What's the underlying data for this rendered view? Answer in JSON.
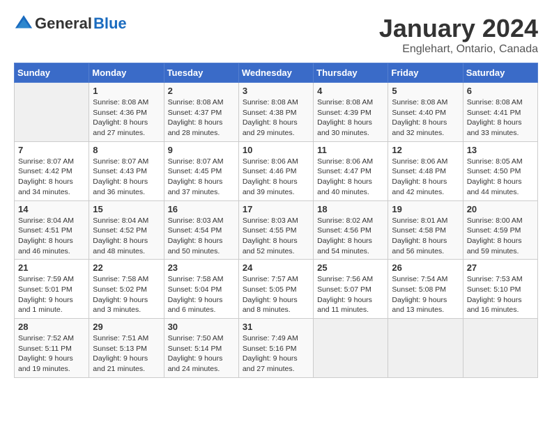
{
  "header": {
    "logo_general": "General",
    "logo_blue": "Blue",
    "title": "January 2024",
    "subtitle": "Englehart, Ontario, Canada"
  },
  "days_of_week": [
    "Sunday",
    "Monday",
    "Tuesday",
    "Wednesday",
    "Thursday",
    "Friday",
    "Saturday"
  ],
  "weeks": [
    [
      {
        "day": "",
        "info": ""
      },
      {
        "day": "1",
        "info": "Sunrise: 8:08 AM\nSunset: 4:36 PM\nDaylight: 8 hours\nand 27 minutes."
      },
      {
        "day": "2",
        "info": "Sunrise: 8:08 AM\nSunset: 4:37 PM\nDaylight: 8 hours\nand 28 minutes."
      },
      {
        "day": "3",
        "info": "Sunrise: 8:08 AM\nSunset: 4:38 PM\nDaylight: 8 hours\nand 29 minutes."
      },
      {
        "day": "4",
        "info": "Sunrise: 8:08 AM\nSunset: 4:39 PM\nDaylight: 8 hours\nand 30 minutes."
      },
      {
        "day": "5",
        "info": "Sunrise: 8:08 AM\nSunset: 4:40 PM\nDaylight: 8 hours\nand 32 minutes."
      },
      {
        "day": "6",
        "info": "Sunrise: 8:08 AM\nSunset: 4:41 PM\nDaylight: 8 hours\nand 33 minutes."
      }
    ],
    [
      {
        "day": "7",
        "info": "Sunrise: 8:07 AM\nSunset: 4:42 PM\nDaylight: 8 hours\nand 34 minutes."
      },
      {
        "day": "8",
        "info": "Sunrise: 8:07 AM\nSunset: 4:43 PM\nDaylight: 8 hours\nand 36 minutes."
      },
      {
        "day": "9",
        "info": "Sunrise: 8:07 AM\nSunset: 4:45 PM\nDaylight: 8 hours\nand 37 minutes."
      },
      {
        "day": "10",
        "info": "Sunrise: 8:06 AM\nSunset: 4:46 PM\nDaylight: 8 hours\nand 39 minutes."
      },
      {
        "day": "11",
        "info": "Sunrise: 8:06 AM\nSunset: 4:47 PM\nDaylight: 8 hours\nand 40 minutes."
      },
      {
        "day": "12",
        "info": "Sunrise: 8:06 AM\nSunset: 4:48 PM\nDaylight: 8 hours\nand 42 minutes."
      },
      {
        "day": "13",
        "info": "Sunrise: 8:05 AM\nSunset: 4:50 PM\nDaylight: 8 hours\nand 44 minutes."
      }
    ],
    [
      {
        "day": "14",
        "info": "Sunrise: 8:04 AM\nSunset: 4:51 PM\nDaylight: 8 hours\nand 46 minutes."
      },
      {
        "day": "15",
        "info": "Sunrise: 8:04 AM\nSunset: 4:52 PM\nDaylight: 8 hours\nand 48 minutes."
      },
      {
        "day": "16",
        "info": "Sunrise: 8:03 AM\nSunset: 4:54 PM\nDaylight: 8 hours\nand 50 minutes."
      },
      {
        "day": "17",
        "info": "Sunrise: 8:03 AM\nSunset: 4:55 PM\nDaylight: 8 hours\nand 52 minutes."
      },
      {
        "day": "18",
        "info": "Sunrise: 8:02 AM\nSunset: 4:56 PM\nDaylight: 8 hours\nand 54 minutes."
      },
      {
        "day": "19",
        "info": "Sunrise: 8:01 AM\nSunset: 4:58 PM\nDaylight: 8 hours\nand 56 minutes."
      },
      {
        "day": "20",
        "info": "Sunrise: 8:00 AM\nSunset: 4:59 PM\nDaylight: 8 hours\nand 59 minutes."
      }
    ],
    [
      {
        "day": "21",
        "info": "Sunrise: 7:59 AM\nSunset: 5:01 PM\nDaylight: 9 hours\nand 1 minute."
      },
      {
        "day": "22",
        "info": "Sunrise: 7:58 AM\nSunset: 5:02 PM\nDaylight: 9 hours\nand 3 minutes."
      },
      {
        "day": "23",
        "info": "Sunrise: 7:58 AM\nSunset: 5:04 PM\nDaylight: 9 hours\nand 6 minutes."
      },
      {
        "day": "24",
        "info": "Sunrise: 7:57 AM\nSunset: 5:05 PM\nDaylight: 9 hours\nand 8 minutes."
      },
      {
        "day": "25",
        "info": "Sunrise: 7:56 AM\nSunset: 5:07 PM\nDaylight: 9 hours\nand 11 minutes."
      },
      {
        "day": "26",
        "info": "Sunrise: 7:54 AM\nSunset: 5:08 PM\nDaylight: 9 hours\nand 13 minutes."
      },
      {
        "day": "27",
        "info": "Sunrise: 7:53 AM\nSunset: 5:10 PM\nDaylight: 9 hours\nand 16 minutes."
      }
    ],
    [
      {
        "day": "28",
        "info": "Sunrise: 7:52 AM\nSunset: 5:11 PM\nDaylight: 9 hours\nand 19 minutes."
      },
      {
        "day": "29",
        "info": "Sunrise: 7:51 AM\nSunset: 5:13 PM\nDaylight: 9 hours\nand 21 minutes."
      },
      {
        "day": "30",
        "info": "Sunrise: 7:50 AM\nSunset: 5:14 PM\nDaylight: 9 hours\nand 24 minutes."
      },
      {
        "day": "31",
        "info": "Sunrise: 7:49 AM\nSunset: 5:16 PM\nDaylight: 9 hours\nand 27 minutes."
      },
      {
        "day": "",
        "info": ""
      },
      {
        "day": "",
        "info": ""
      },
      {
        "day": "",
        "info": ""
      }
    ]
  ]
}
